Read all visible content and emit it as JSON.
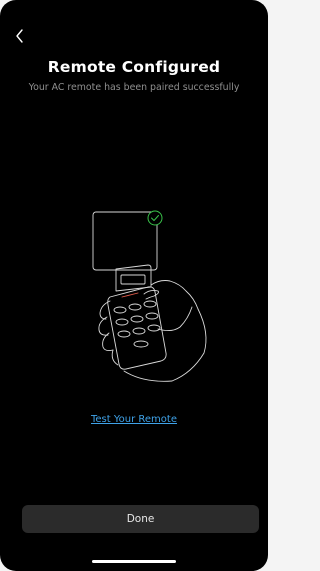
{
  "header": {
    "back_icon": "chevron-left-icon",
    "title": "Remote Configured",
    "subtitle": "Your AC remote has been paired successfully"
  },
  "illustration": {
    "description_icon": "hand-holding-remote-icon",
    "status_icon": "check-circle-icon",
    "status_color": "#39c24a"
  },
  "actions": {
    "test_link_label": "Test Your Remote",
    "test_link_color": "#3fa2e8",
    "done_label": "Done"
  },
  "theme": {
    "background": "#000000",
    "button_background": "#2b2b2b"
  }
}
